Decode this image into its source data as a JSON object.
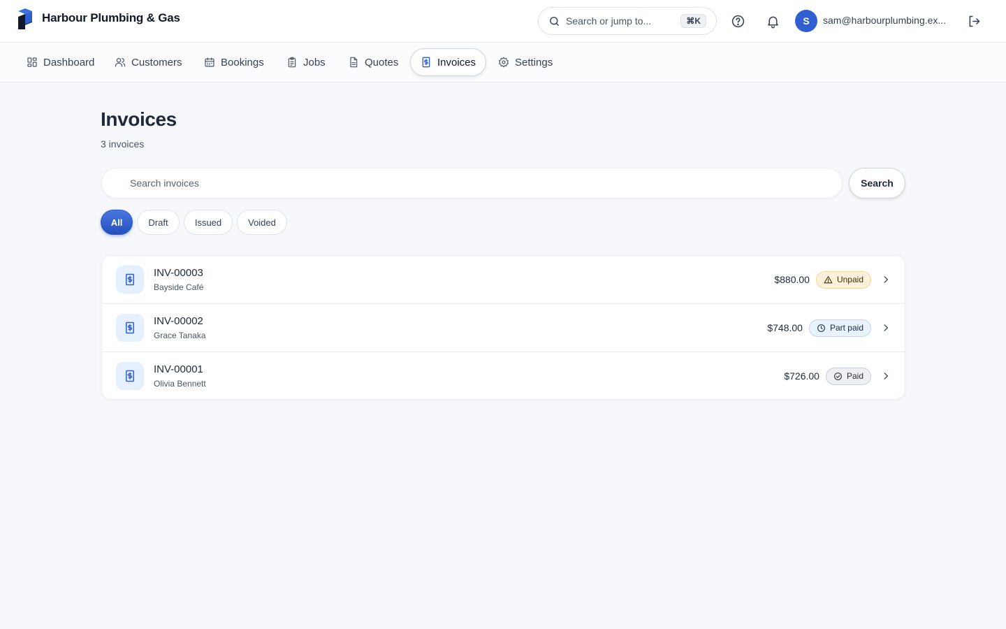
{
  "app": {
    "name": "Harbour Plumbing & Gas"
  },
  "header": {
    "search_placeholder": "Search or jump to...",
    "shortcut": "⌘K",
    "user_initial": "S",
    "user_email": "sam@harbourplumbing.ex..."
  },
  "nav": {
    "items": [
      {
        "label": "Dashboard",
        "icon": "grid-icon"
      },
      {
        "label": "Customers",
        "icon": "users-icon"
      },
      {
        "label": "Bookings",
        "icon": "calendar-icon"
      },
      {
        "label": "Jobs",
        "icon": "clipboard-icon"
      },
      {
        "label": "Quotes",
        "icon": "document-icon"
      },
      {
        "label": "Invoices",
        "icon": "invoice-icon",
        "active": true
      },
      {
        "label": "Settings",
        "icon": "gear-icon"
      }
    ]
  },
  "page": {
    "title": "Invoices",
    "count_label": "3 invoices",
    "search_placeholder": "Search invoices",
    "search_button": "Search"
  },
  "filters": [
    {
      "label": "All",
      "active": true
    },
    {
      "label": "Draft"
    },
    {
      "label": "Issued"
    },
    {
      "label": "Voided"
    }
  ],
  "invoices": [
    {
      "number": "INV-00003",
      "customer": "Bayside Café",
      "amount": "$880.00",
      "status": "Unpaid"
    },
    {
      "number": "INV-00002",
      "customer": "Grace Tanaka",
      "amount": "$748.00",
      "status": "Part paid"
    },
    {
      "number": "INV-00001",
      "customer": "Olivia Bennett",
      "amount": "$726.00",
      "status": "Paid"
    }
  ],
  "colors": {
    "accent": "#2f5fd0",
    "unpaid": "#fdf2d9",
    "part_paid": "#e8f3fd",
    "paid": "#eef0f3"
  }
}
